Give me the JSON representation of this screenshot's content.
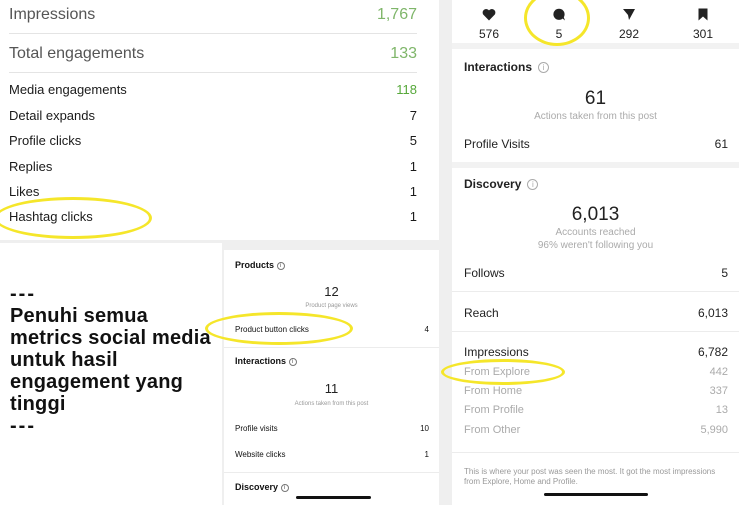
{
  "tweet_activity": {
    "rows": [
      {
        "label": "Impressions",
        "value": "1,767"
      },
      {
        "label": "Total engagements",
        "value": "133"
      },
      {
        "label": "Media engagements",
        "value": "118"
      },
      {
        "label": "Detail expands",
        "value": "7"
      },
      {
        "label": "Profile clicks",
        "value": "5"
      },
      {
        "label": "Replies",
        "value": "1"
      },
      {
        "label": "Likes",
        "value": "1"
      },
      {
        "label": "Hashtag clicks",
        "value": "1"
      }
    ]
  },
  "promo": {
    "dash_top": "---",
    "text": "Penuhi semua metrics social media untuk hasil engagement yang tinggi",
    "dash_bottom": "---"
  },
  "ig_small": {
    "products_heading": "Products",
    "product_page_views_value": "12",
    "product_page_views_label": "Product page views",
    "product_button_clicks_label": "Product button clicks",
    "product_button_clicks_value": "4",
    "interactions_heading": "Interactions",
    "actions_value": "11",
    "actions_label": "Actions taken from this post",
    "profile_visits_label": "Profile visits",
    "profile_visits_value": "10",
    "website_clicks_label": "Website clicks",
    "website_clicks_value": "1",
    "discovery_heading": "Discovery"
  },
  "ig_large": {
    "stats": [
      {
        "icon": "heart-icon",
        "value": "576"
      },
      {
        "icon": "comment-icon",
        "value": "5"
      },
      {
        "icon": "send-icon",
        "value": "292"
      },
      {
        "icon": "bookmark-icon",
        "value": "301"
      }
    ],
    "interactions_heading": "Interactions",
    "actions_value": "61",
    "actions_label": "Actions taken from this post",
    "profile_visits_label": "Profile Visits",
    "profile_visits_value": "61",
    "discovery_heading": "Discovery",
    "reached_value": "6,013",
    "reached_label": "Accounts reached",
    "reached_sub": "96% weren't following you",
    "follows_label": "Follows",
    "follows_value": "5",
    "reach_label": "Reach",
    "reach_value": "6,013",
    "impressions_label": "Impressions",
    "impressions_value": "6,782",
    "from_explore_label": "From Explore",
    "from_explore_value": "442",
    "from_home_label": "From Home",
    "from_home_value": "337",
    "from_profile_label": "From Profile",
    "from_profile_value": "13",
    "from_other_label": "From Other",
    "from_other_value": "5,990",
    "note": "This is where your post was seen the most. It got the most impressions from Explore, Home and Profile."
  },
  "colors": {
    "highlight": "#f5e62a",
    "value_green": "#56a83a"
  }
}
